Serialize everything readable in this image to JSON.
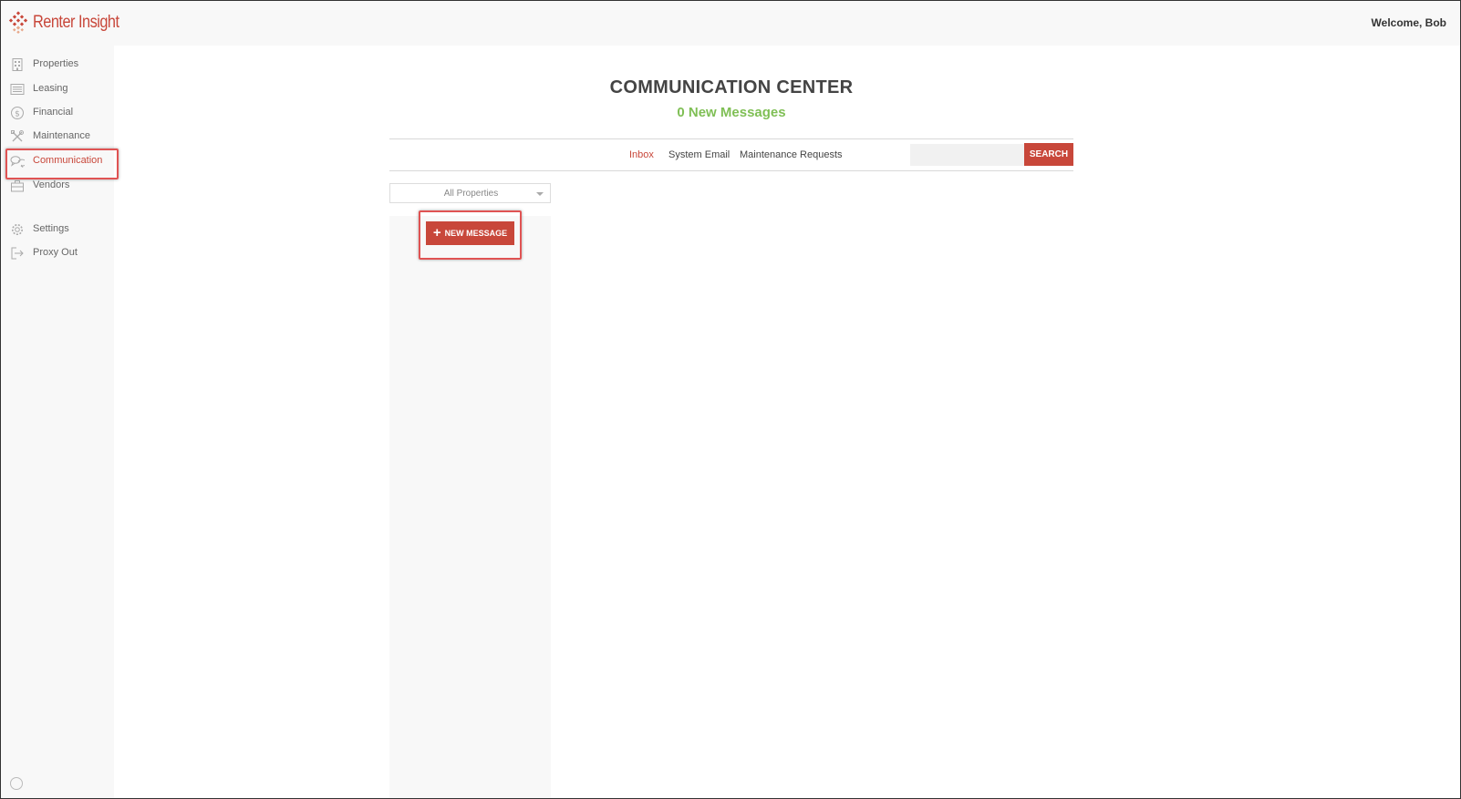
{
  "brand": {
    "name": "Renter Insight",
    "accent_color": "#c8473a",
    "logo_icon": "diamond-grid-logo-icon"
  },
  "header": {
    "welcome_text": "Welcome, Bob"
  },
  "sidebar": {
    "items": [
      {
        "label": "Properties",
        "icon": "building-icon",
        "active": false
      },
      {
        "label": "Leasing",
        "icon": "list-icon",
        "active": false
      },
      {
        "label": "Financial",
        "icon": "dollar-icon",
        "active": false
      },
      {
        "label": "Maintenance",
        "icon": "tools-icon",
        "active": false
      },
      {
        "label": "Communication",
        "icon": "chat-bubbles-icon",
        "active": true
      },
      {
        "label": "Vendors",
        "icon": "briefcase-icon",
        "active": false
      },
      {
        "label": "Settings",
        "icon": "gear-icon",
        "active": false
      },
      {
        "label": "Proxy Out",
        "icon": "logout-icon",
        "active": false
      }
    ]
  },
  "main": {
    "title": "COMMUNICATION CENTER",
    "subtitle": "0 New Messages",
    "subtitle_color": "#7fbf55",
    "tabs": [
      {
        "label": "Inbox",
        "active": true
      },
      {
        "label": "System Email",
        "active": false
      },
      {
        "label": "Maintenance Requests",
        "active": false
      }
    ],
    "search": {
      "placeholder": "",
      "button_label": "SEARCH"
    },
    "property_filter": {
      "selected": "All Properties"
    },
    "new_message_button": {
      "icon": "plus-icon",
      "label": "NEW MESSAGE"
    }
  }
}
